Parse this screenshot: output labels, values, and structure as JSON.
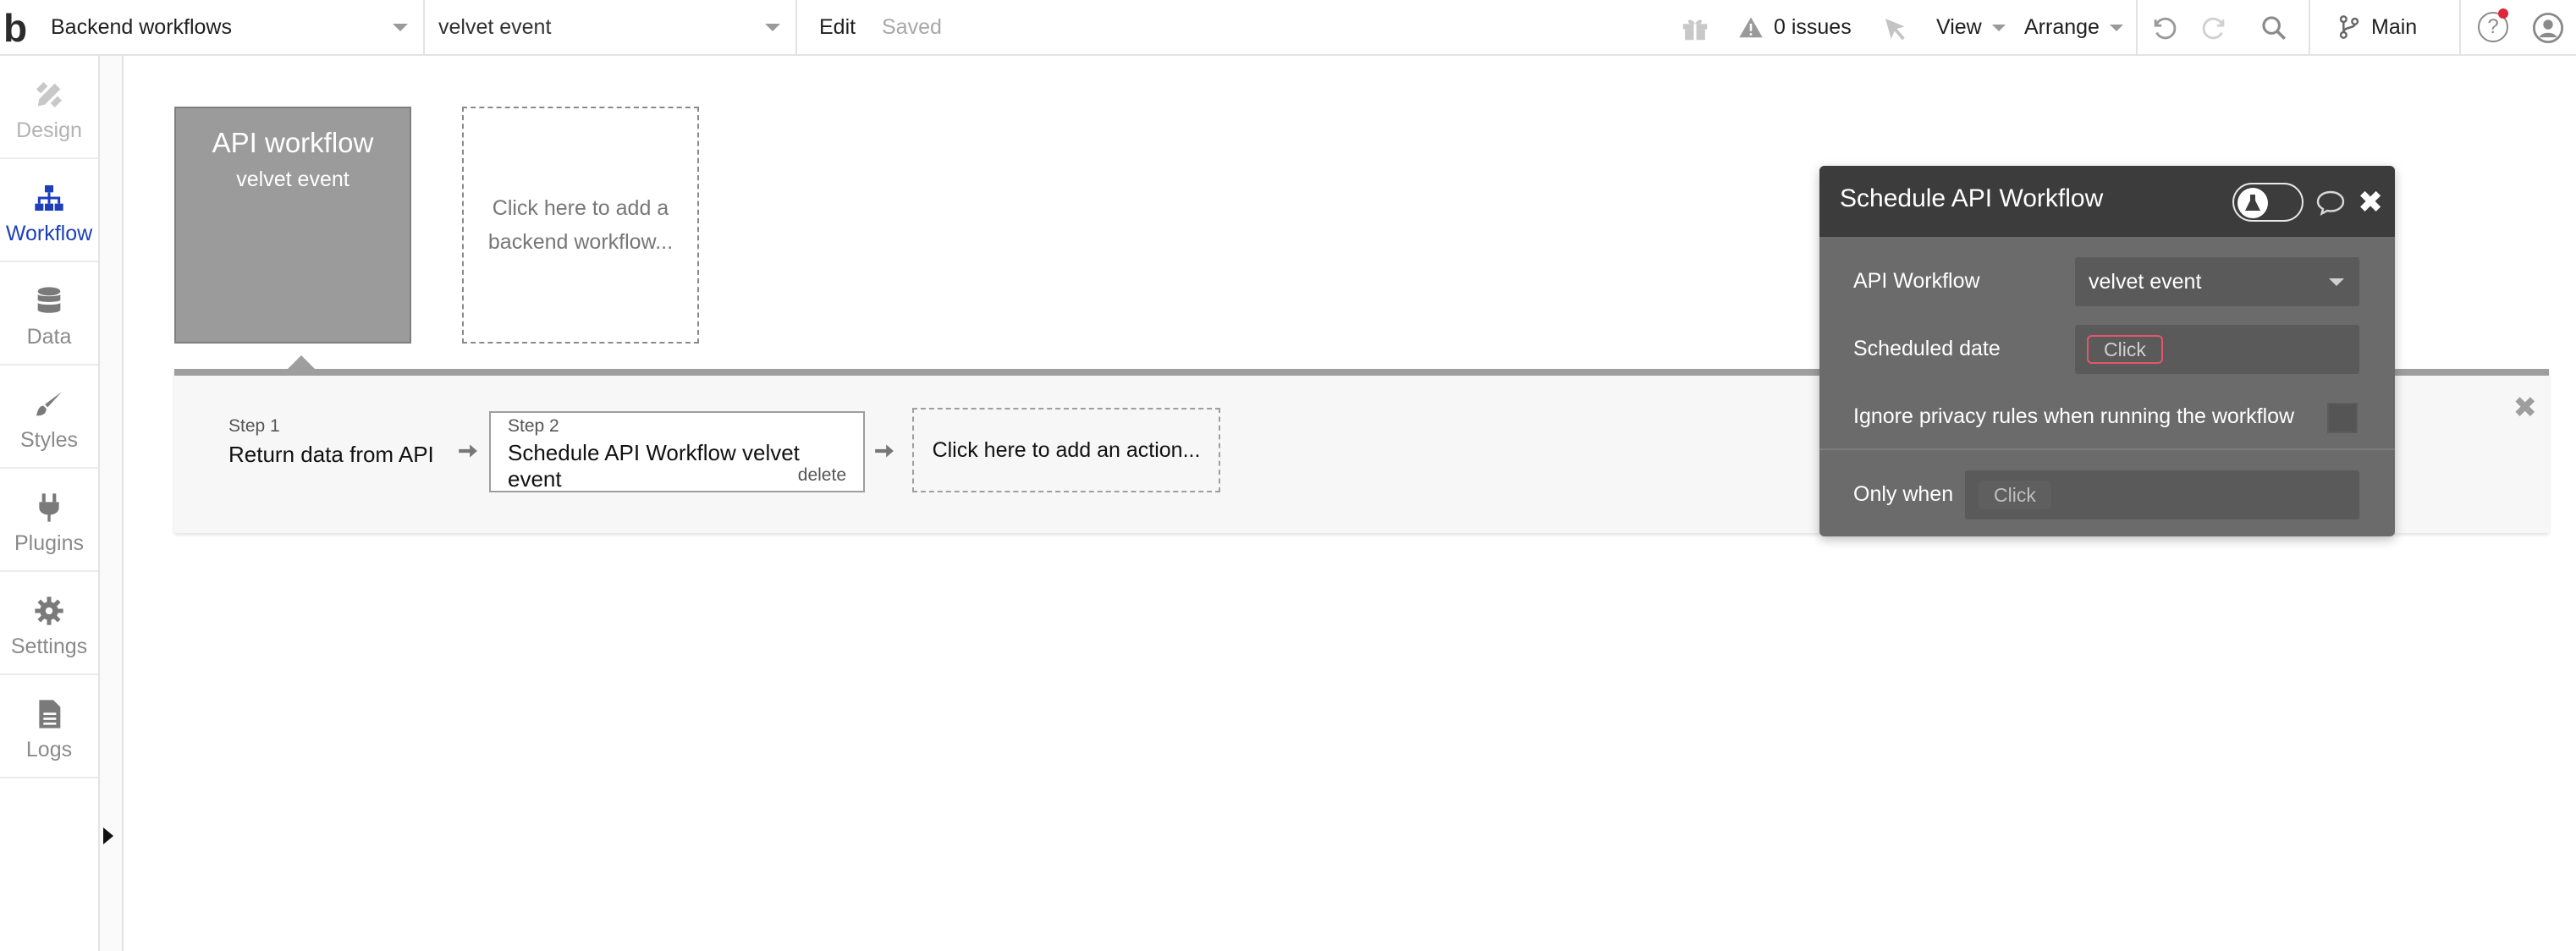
{
  "topbar": {
    "logo": "b",
    "page_dropdown": "Backend workflows",
    "workflow_dropdown": "velvet event",
    "edit_label": "Edit",
    "saved_label": "Saved",
    "issues_label": "0 issues",
    "view_label": "View",
    "arrange_label": "Arrange",
    "branch_label": "Main"
  },
  "sidebar": {
    "items": [
      {
        "label": "Design",
        "icon": "pencil-ruler-icon",
        "state": "disabled"
      },
      {
        "label": "Workflow",
        "icon": "sitemap-icon",
        "state": "active"
      },
      {
        "label": "Data",
        "icon": "database-icon",
        "state": "normal"
      },
      {
        "label": "Styles",
        "icon": "brush-icon",
        "state": "normal"
      },
      {
        "label": "Plugins",
        "icon": "plug-icon",
        "state": "normal"
      },
      {
        "label": "Settings",
        "icon": "gear-icon",
        "state": "normal"
      },
      {
        "label": "Logs",
        "icon": "document-icon",
        "state": "normal"
      }
    ]
  },
  "canvas": {
    "trigger_title": "API workflow",
    "trigger_subtitle": "velvet event",
    "add_backend_line1": "Click here to add a",
    "add_backend_line2": "backend workflow..."
  },
  "actions": {
    "step1_label": "Step 1",
    "step1_title": "Return data from API",
    "step2_label": "Step 2",
    "step2_title": "Schedule API Workflow velvet event",
    "step2_delete": "delete",
    "add_action": "Click here to add an action..."
  },
  "editor": {
    "title": "Schedule API Workflow velvet event",
    "api_workflow_label": "API Workflow",
    "api_workflow_value": "velvet event",
    "scheduled_date_label": "Scheduled date",
    "scheduled_date_placeholder": "Click",
    "ignore_privacy_label": "Ignore privacy rules when running the workflow",
    "only_when_label": "Only when",
    "only_when_placeholder": "Click"
  },
  "colors": {
    "active_accent": "#1d3fbb",
    "editor_bg": "#6b6b6b",
    "editor_header": "#3c3c3c",
    "invalid_field_border": "#e5566a",
    "trigger_bg": "#9b9b9b"
  }
}
